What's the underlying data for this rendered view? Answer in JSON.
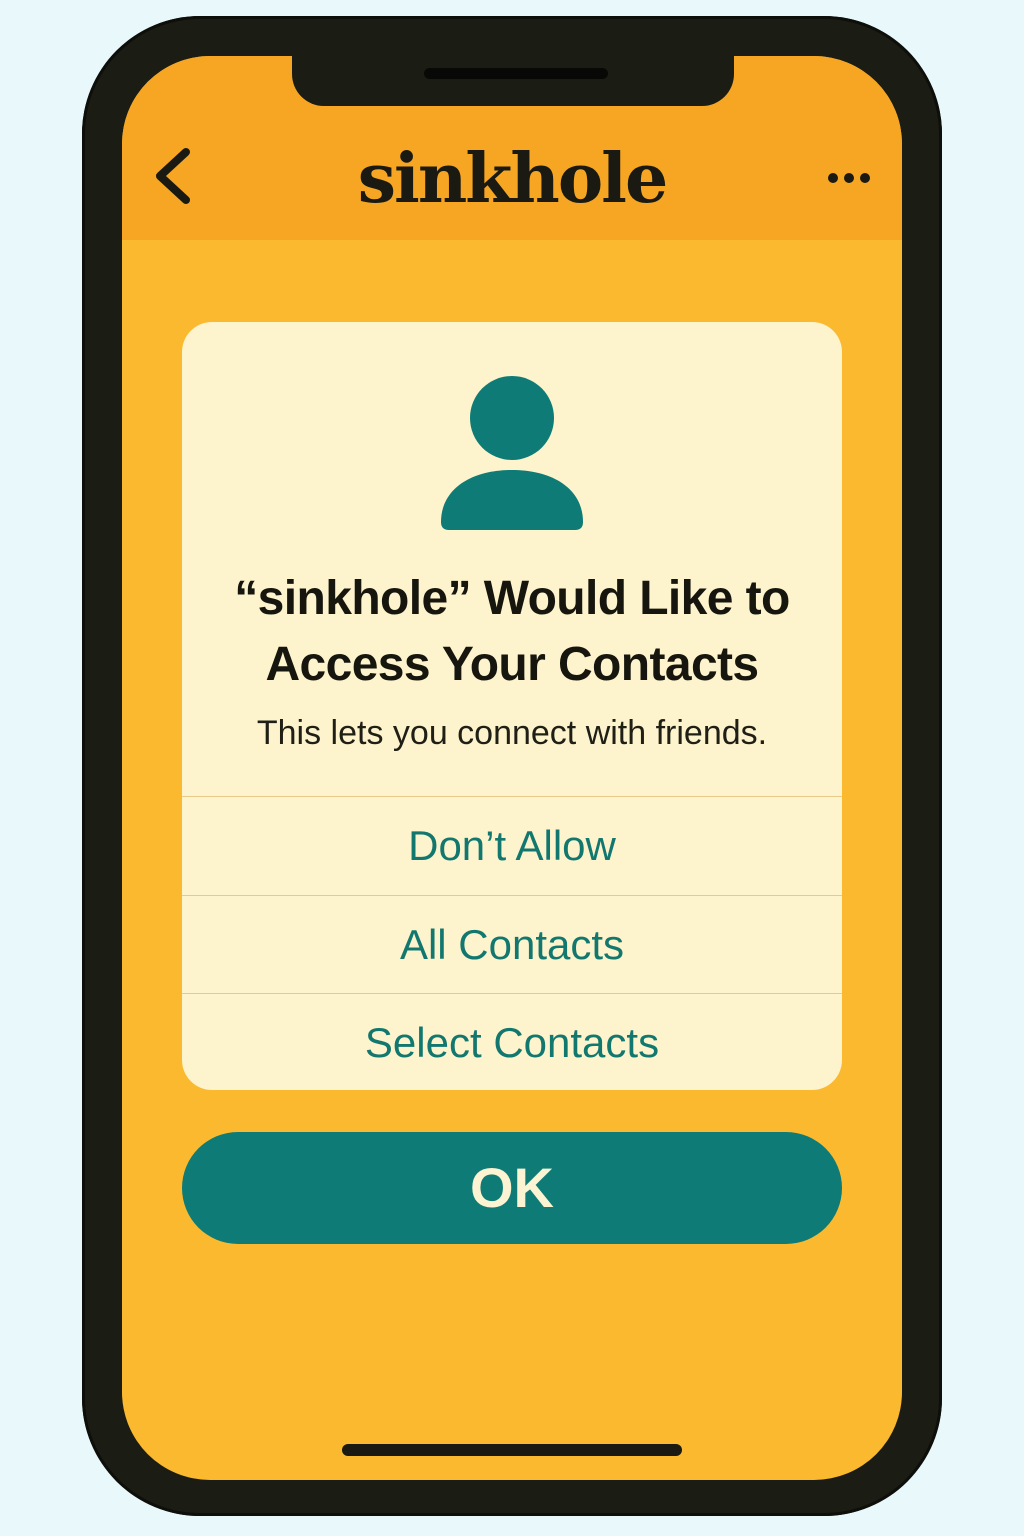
{
  "header": {
    "title": "sinkhole",
    "back_icon": "chevron-left-icon",
    "more_icon": "ellipsis-icon"
  },
  "permission_dialog": {
    "icon": "person-icon",
    "title": "“sinkhole” Would Like to Access Your Contacts",
    "message": "This lets you connect with friends.",
    "options": [
      {
        "label": "Don’t Allow"
      },
      {
        "label": "All Contacts"
      },
      {
        "label": "Select Contacts"
      }
    ]
  },
  "ok_button": {
    "label": "OK"
  },
  "colors": {
    "background": "#e9f8fb",
    "header": "#f6a623",
    "screen": "#fbb92f",
    "dialog": "#fdf3cc",
    "accent": "#0e7b76",
    "text_dark": "#16160f"
  }
}
